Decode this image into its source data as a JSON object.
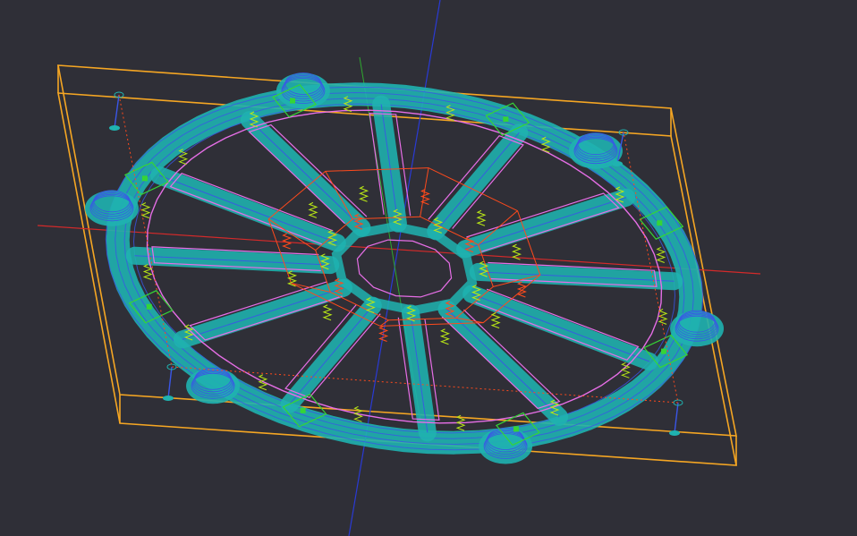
{
  "viewport": {
    "kind": "3d-toolpath-preview",
    "spoke_count": 12,
    "colors": {
      "background": "#2f2f37",
      "stock_box": "#f5a623",
      "x_axis": "#d42a2a",
      "y_axis": "#2fa82f",
      "z_axis": "#2a3ad4",
      "slot_fill": "#1fb3b0",
      "slot_rapid": "#3a56e6",
      "contour": "#e66ee6",
      "plunge": "#b8e616",
      "center_rapid": "#ff4a1c",
      "marker": "#36d436"
    }
  }
}
